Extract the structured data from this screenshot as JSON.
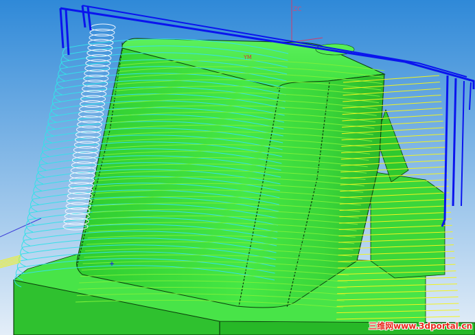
{
  "viewport": {
    "background_top": "#2f89d8",
    "background_bottom": "#e4eef8"
  },
  "axes": {
    "zc_label": "ZC",
    "ym_label": "YM",
    "axis_color": "#d23a6a"
  },
  "model": {
    "body_color": "#3ee03e",
    "body_dark": "#24b824",
    "base_color": "#2ec42e",
    "edge_color": "#0a3a0a"
  },
  "toolpaths": {
    "cyan_color": "#36e0e8",
    "white_color": "#f4f8ff",
    "yellow_color": "#f4f41c",
    "green_color": "#7cf03a",
    "blue_color": "#0a14ee"
  },
  "watermark": {
    "text": "三维网www.3dportal.cn",
    "color": "#e8281e"
  }
}
